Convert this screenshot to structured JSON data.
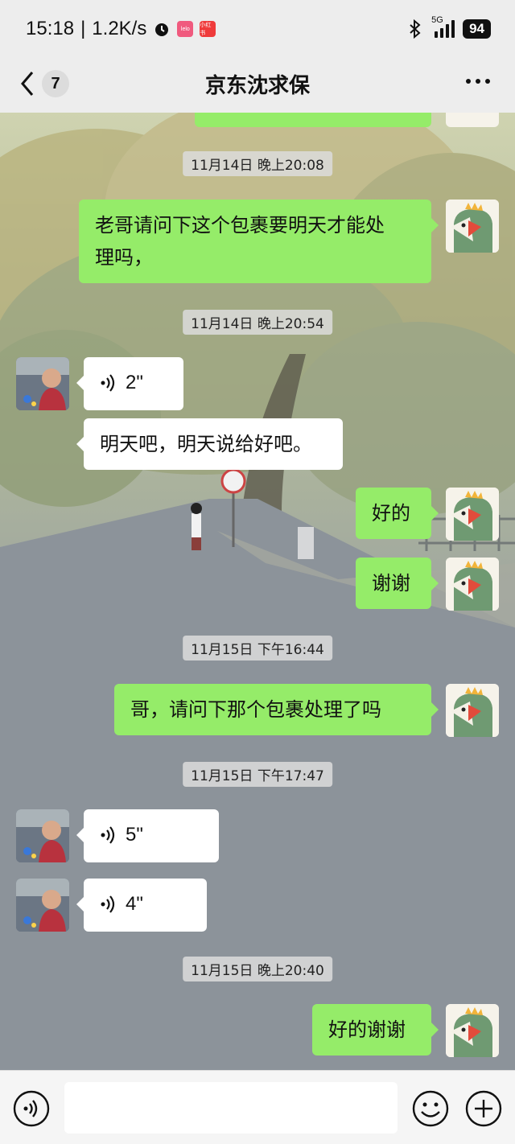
{
  "status_bar": {
    "time": "15:18",
    "net_speed": "1.2K/s",
    "battery": "94",
    "network": "5G",
    "app_icons": [
      "lelo",
      "小红书"
    ]
  },
  "nav": {
    "unread_count": "7",
    "title": "京东沈求保"
  },
  "messages": [
    {
      "type": "timestamp",
      "text": "11月14日 晚上20:08"
    },
    {
      "type": "text",
      "from": "me",
      "lines": [
        "老哥请问下这个包裹要明天才能处",
        "理吗，"
      ]
    },
    {
      "type": "timestamp",
      "text": "11月14日 晚上20:54"
    },
    {
      "type": "voice",
      "from": "them",
      "duration": "2\""
    },
    {
      "type": "text",
      "from": "them",
      "lines": [
        "明天吧，明天说给好吧。"
      ]
    },
    {
      "type": "text",
      "from": "me",
      "lines": [
        "好的"
      ]
    },
    {
      "type": "text",
      "from": "me",
      "lines": [
        "谢谢"
      ]
    },
    {
      "type": "timestamp",
      "text": "11月15日 下午16:44"
    },
    {
      "type": "text",
      "from": "me",
      "lines": [
        "哥，请问下那个包裹处理了吗"
      ]
    },
    {
      "type": "timestamp",
      "text": "11月15日 下午17:47"
    },
    {
      "type": "voice",
      "from": "them",
      "duration": "5\""
    },
    {
      "type": "voice",
      "from": "them",
      "duration": "4\""
    },
    {
      "type": "timestamp",
      "text": "11月15日 晚上20:40"
    },
    {
      "type": "text",
      "from": "me",
      "lines": [
        "好的谢谢"
      ]
    }
  ],
  "input_bar": {
    "placeholder": "",
    "icons": [
      "voice-input-icon",
      "emoji-icon",
      "plus-icon"
    ]
  },
  "colors": {
    "my_bubble": "#95ec69",
    "their_bubble": "#ffffff",
    "bar_bg": "#ededed"
  }
}
